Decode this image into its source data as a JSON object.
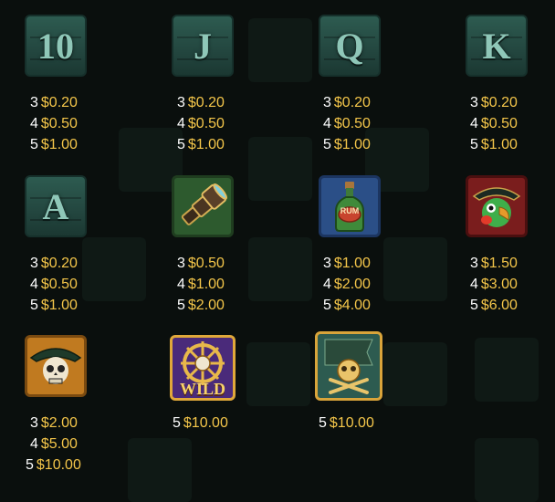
{
  "symbols": [
    {
      "id": "ten",
      "label": "10",
      "pays": [
        {
          "n": "3",
          "v": "$0.20"
        },
        {
          "n": "4",
          "v": "$0.50"
        },
        {
          "n": "5",
          "v": "$1.00"
        }
      ]
    },
    {
      "id": "jack",
      "label": "J",
      "pays": [
        {
          "n": "3",
          "v": "$0.20"
        },
        {
          "n": "4",
          "v": "$0.50"
        },
        {
          "n": "5",
          "v": "$1.00"
        }
      ]
    },
    {
      "id": "queen",
      "label": "Q",
      "pays": [
        {
          "n": "3",
          "v": "$0.20"
        },
        {
          "n": "4",
          "v": "$0.50"
        },
        {
          "n": "5",
          "v": "$1.00"
        }
      ]
    },
    {
      "id": "king",
      "label": "K",
      "pays": [
        {
          "n": "3",
          "v": "$0.20"
        },
        {
          "n": "4",
          "v": "$0.50"
        },
        {
          "n": "5",
          "v": "$1.00"
        }
      ]
    },
    {
      "id": "ace",
      "label": "A",
      "pays": [
        {
          "n": "3",
          "v": "$0.20"
        },
        {
          "n": "4",
          "v": "$0.50"
        },
        {
          "n": "5",
          "v": "$1.00"
        }
      ]
    },
    {
      "id": "spyglass",
      "icon": "spyglass-icon",
      "pays": [
        {
          "n": "3",
          "v": "$0.50"
        },
        {
          "n": "4",
          "v": "$1.00"
        },
        {
          "n": "5",
          "v": "$2.00"
        }
      ]
    },
    {
      "id": "rum",
      "icon": "rum-bottle-icon",
      "label": "RUM",
      "pays": [
        {
          "n": "3",
          "v": "$1.00"
        },
        {
          "n": "4",
          "v": "$2.00"
        },
        {
          "n": "5",
          "v": "$4.00"
        }
      ]
    },
    {
      "id": "parrot",
      "icon": "parrot-icon",
      "pays": [
        {
          "n": "3",
          "v": "$1.50"
        },
        {
          "n": "4",
          "v": "$3.00"
        },
        {
          "n": "5",
          "v": "$6.00"
        }
      ]
    },
    {
      "id": "skull",
      "icon": "pirate-skull-icon",
      "pays": [
        {
          "n": "3",
          "v": "$2.00"
        },
        {
          "n": "4",
          "v": "$5.00"
        },
        {
          "n": "5",
          "v": "$10.00"
        }
      ]
    },
    {
      "id": "wild",
      "icon": "ship-wheel-wild-icon",
      "label": "WILD",
      "pays": [
        {
          "n": "5",
          "v": "$10.00"
        }
      ]
    },
    {
      "id": "flag",
      "icon": "jolly-roger-flag-icon",
      "pays": [
        {
          "n": "5",
          "v": "$10.00"
        }
      ]
    }
  ],
  "colors": {
    "payout": "#f4c64a",
    "count": "#ffffff",
    "plank": "#2d5b50",
    "background": "#0a0f0d"
  }
}
